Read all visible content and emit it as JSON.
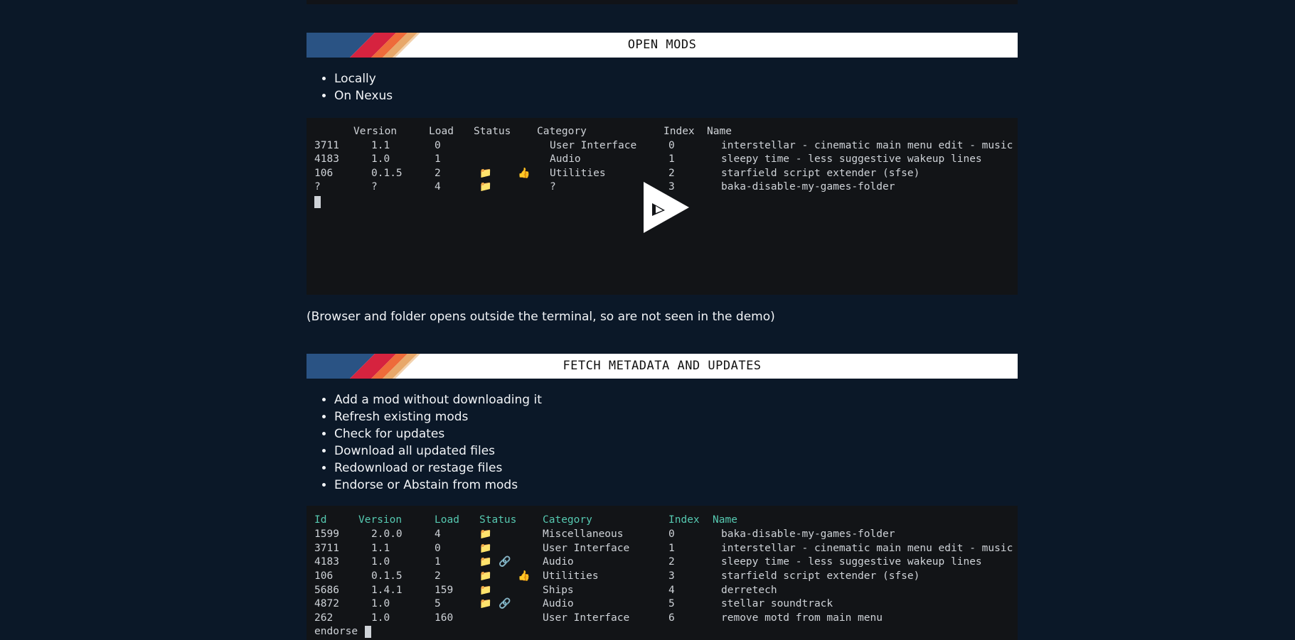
{
  "sections": {
    "open_mods": {
      "title": "Open Mods",
      "bullets": [
        "Locally",
        "On Nexus"
      ],
      "terminal": {
        "headers": {
          "version": "Version",
          "load": "Load",
          "status": "Status",
          "category": "Category",
          "index": "Index",
          "name": "Name"
        },
        "rows": [
          {
            "id": "3711",
            "version": "1.1",
            "load": "0",
            "status1": "",
            "status2": "",
            "category": "User Interface",
            "index": "0",
            "name": "interstellar - cinematic main menu edit - music"
          },
          {
            "id": "4183",
            "version": "1.0",
            "load": "1",
            "status1": "",
            "status2": "",
            "category": "Audio",
            "index": "1",
            "name": "sleepy time - less suggestive wakeup lines"
          },
          {
            "id": "106",
            "version": "0.1.5",
            "load": "2",
            "status1": "📁",
            "status2": "👍",
            "category": "Utilities",
            "index": "2",
            "name": "starfield script extender (sfse)"
          },
          {
            "id": "?",
            "version": "?",
            "load": "4",
            "status1": "📁",
            "status2": "",
            "category": "?",
            "index": "3",
            "name": "baka-disable-my-games-folder"
          }
        ],
        "play_icon": "play-icon"
      },
      "caption": "(Browser and folder opens outside the terminal, so are not seen in the demo)"
    },
    "fetch_metadata": {
      "title": "Fetch Metadata and Updates",
      "bullets": [
        "Add a mod without downloading it",
        "Refresh existing mods",
        "Check for updates",
        "Download all updated files",
        "Redownload or restage files",
        "Endorse or Abstain from mods"
      ],
      "terminal": {
        "headers": {
          "id": "Id",
          "version": "Version",
          "load": "Load",
          "status": "Status",
          "category": "Category",
          "index": "Index",
          "name": "Name"
        },
        "rows": [
          {
            "id": "1599",
            "version": "2.0.0",
            "load": "4",
            "status1": "📁",
            "status2": "",
            "status3": "",
            "category": "Miscellaneous",
            "index": "0",
            "name": "baka-disable-my-games-folder"
          },
          {
            "id": "3711",
            "version": "1.1",
            "load": "0",
            "status1": "📁",
            "status2": "",
            "status3": "",
            "category": "User Interface",
            "index": "1",
            "name": "interstellar - cinematic main menu edit - music"
          },
          {
            "id": "4183",
            "version": "1.0",
            "load": "1",
            "status1": "📁",
            "status2": "🔗",
            "status3": "",
            "category": "Audio",
            "index": "2",
            "name": "sleepy time - less suggestive wakeup lines"
          },
          {
            "id": "106",
            "version": "0.1.5",
            "load": "2",
            "status1": "📁",
            "status2": "",
            "status3": "👍",
            "category": "Utilities",
            "index": "3",
            "name": "starfield script extender (sfse)"
          },
          {
            "id": "5686",
            "version": "1.4.1",
            "load": "159",
            "status1": "📁",
            "status2": "",
            "status3": "",
            "category": "Ships",
            "index": "4",
            "name": "derretech"
          },
          {
            "id": "4872",
            "version": "1.0",
            "load": "5",
            "status1": "📁",
            "status2": "🔗",
            "status3": "",
            "category": "Audio",
            "index": "5",
            "name": "stellar soundtrack"
          },
          {
            "id": "262",
            "version": "1.0",
            "load": "160",
            "status1": "",
            "status2": "",
            "status3": "",
            "category": "User Interface",
            "index": "6",
            "name": "remove motd from main menu"
          }
        ],
        "prompt": "endorse"
      }
    }
  },
  "colors": {
    "page_bg": "#0b1828",
    "terminal_bg": "#121417",
    "header_accent": "#56c9b1",
    "stripe_blue": "#2a5384",
    "stripe_red": "#d6233f",
    "stripe_orange": "#ee6b3a",
    "stripe_peach": "#e8a86a"
  }
}
